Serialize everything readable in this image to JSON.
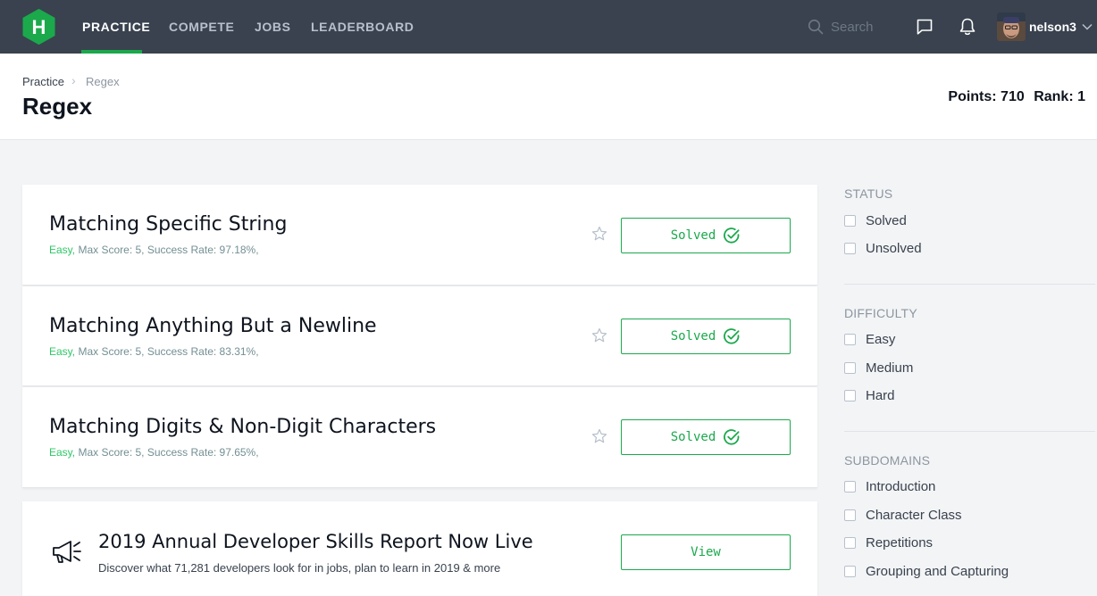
{
  "nav": {
    "logo_letter": "H",
    "items": [
      "PRACTICE",
      "COMPETE",
      "JOBS",
      "LEADERBOARD"
    ],
    "active_item": "PRACTICE",
    "search_placeholder": "Search",
    "username": "nelson3"
  },
  "header": {
    "breadcrumb": [
      "Practice",
      "Regex"
    ],
    "title": "Regex",
    "points_label": "Points: 710",
    "rank_label": "Rank: 1"
  },
  "challenges": [
    {
      "title": "Matching Specific String",
      "difficulty": "Easy,",
      "meta": "Max Score: 5, Success Rate: 97.18%,",
      "button_label": "Solved"
    },
    {
      "title": "Matching Anything But a Newline",
      "difficulty": "Easy,",
      "meta": "Max Score: 5, Success Rate: 83.31%,",
      "button_label": "Solved"
    },
    {
      "title": "Matching Digits & Non-Digit Characters",
      "difficulty": "Easy,",
      "meta": "Max Score: 5, Success Rate: 97.65%,",
      "button_label": "Solved"
    }
  ],
  "promo": {
    "title": "2019 Annual Developer Skills Report Now Live",
    "description": "Discover what 71,281 developers look for in jobs, plan to learn in 2019 & more",
    "button_label": "View"
  },
  "filters": {
    "status": {
      "heading": "STATUS",
      "options": [
        "Solved",
        "Unsolved"
      ]
    },
    "difficulty": {
      "heading": "DIFFICULTY",
      "options": [
        "Easy",
        "Medium",
        "Hard"
      ]
    },
    "subdomains": {
      "heading": "SUBDOMAINS",
      "options": [
        "Introduction",
        "Character Class",
        "Repetitions",
        "Grouping and Capturing"
      ]
    }
  },
  "colors": {
    "nav_bg": "#39424e",
    "accent_green": "#1ba94c",
    "easy_green": "#2ec866"
  }
}
